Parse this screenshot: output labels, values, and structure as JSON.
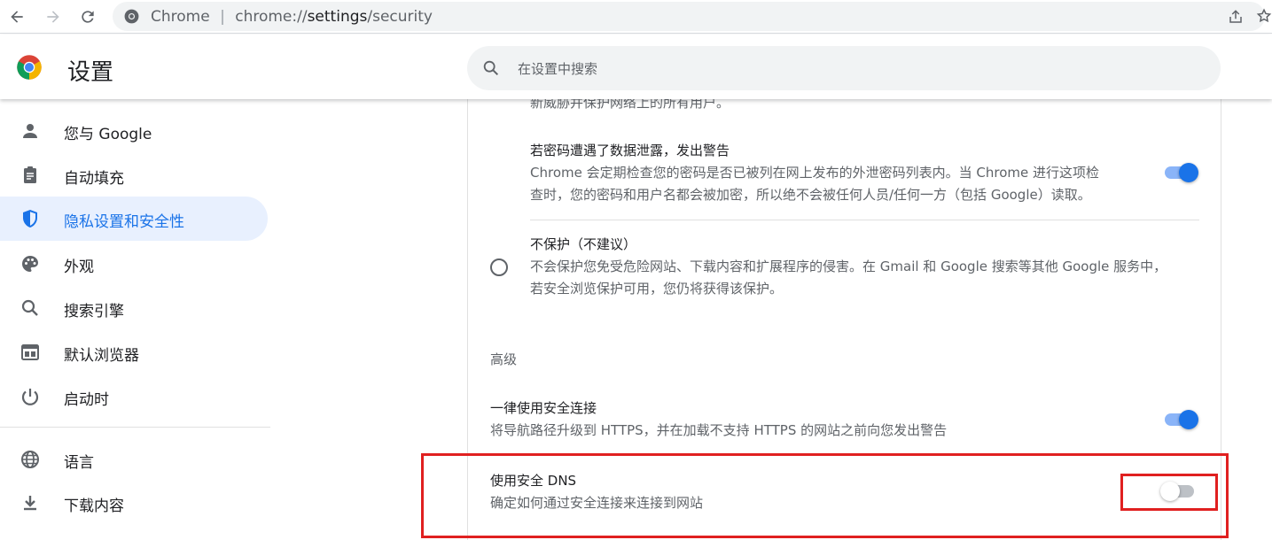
{
  "browser": {
    "omnibox_site": "Chrome",
    "omnibox_sep": "|",
    "omnibox_url_prefix": "chrome://",
    "omnibox_url_path": "settings",
    "omnibox_url_suffix": "/security"
  },
  "header": {
    "title": "设置",
    "search_placeholder": "在设置中搜索"
  },
  "sidebar": {
    "items": [
      {
        "label": "您与 Google",
        "icon": "person-icon",
        "active": false
      },
      {
        "label": "自动填充",
        "icon": "clipboard-icon",
        "active": false
      },
      {
        "label": "隐私设置和安全性",
        "icon": "shield-icon",
        "active": true
      },
      {
        "label": "外观",
        "icon": "palette-icon",
        "active": false
      },
      {
        "label": "搜索引擎",
        "icon": "search-icon",
        "active": false
      },
      {
        "label": "默认浏览器",
        "icon": "browser-window-icon",
        "active": false
      },
      {
        "label": "启动时",
        "icon": "power-icon",
        "active": false
      },
      {
        "label": "语言",
        "icon": "globe-icon",
        "active": false
      },
      {
        "label": "下载内容",
        "icon": "download-icon",
        "active": false
      }
    ]
  },
  "main": {
    "cut_off_text": "新威胁并保护网络上的所有用户。",
    "password_leak": {
      "title": "若密码遭遇了数据泄露，发出警告",
      "desc_line1": "Chrome 会定期检查您的密码是否已被列在网上发布的外泄密码列表内。当 Chrome 进行这项检",
      "desc_line2": "查时，您的密码和用户名都会被加密，所以绝不会被任何人员/任何一方（包括 Google）读取。",
      "enabled": true
    },
    "no_protection": {
      "title": "不保护（不建议）",
      "desc_line1": "不会保护您免受危险网站、下载内容和扩展程序的侵害。在 Gmail 和 Google 搜索等其他 Google 服务中，",
      "desc_line2": "若安全浏览保护可用，您仍将获得该保护。",
      "selected": false
    },
    "advanced_heading": "高级",
    "https_first": {
      "title": "一律使用安全连接",
      "desc": "将导航路径升级到 HTTPS，并在加载不支持 HTTPS 的网站之前向您发出警告",
      "enabled": true
    },
    "secure_dns": {
      "title": "使用安全 DNS",
      "desc": "确定如何通过安全连接来连接到网站",
      "enabled": false
    }
  },
  "colors": {
    "accent": "#1a73e8",
    "highlight_box": "#e02020",
    "active_nav_bg": "#e8f0fe"
  }
}
